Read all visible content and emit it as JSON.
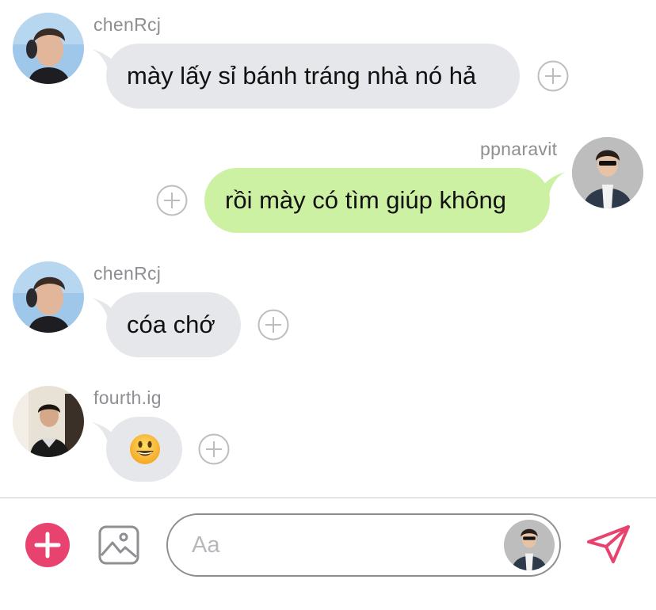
{
  "messages": [
    {
      "sender": "chenRcj",
      "text": "mày lấy sỉ bánh tráng nhà nó hả",
      "direction": "incoming",
      "avatar": "chenrcj-avatar"
    },
    {
      "sender": "ppnaravit",
      "text": "rồi mày có tìm giúp không",
      "direction": "outgoing",
      "avatar": "ppnaravit-avatar"
    },
    {
      "sender": "chenRcj",
      "text": "cóa chớ",
      "direction": "incoming",
      "avatar": "chenrcj-avatar"
    },
    {
      "sender": "fourth.ig",
      "text": "😃",
      "direction": "incoming",
      "avatar": "fourth-avatar"
    }
  ],
  "composer": {
    "placeholder": "Aa",
    "add_icon": "plus-icon",
    "photo_icon": "image-icon",
    "send_icon": "send-icon"
  },
  "colors": {
    "incoming_bubble": "#e6e7ea",
    "outgoing_bubble": "#cdf1a3",
    "accent": "#e8436f",
    "sender_text": "#8e8e93"
  },
  "reaction_icon": "add-reaction-icon"
}
